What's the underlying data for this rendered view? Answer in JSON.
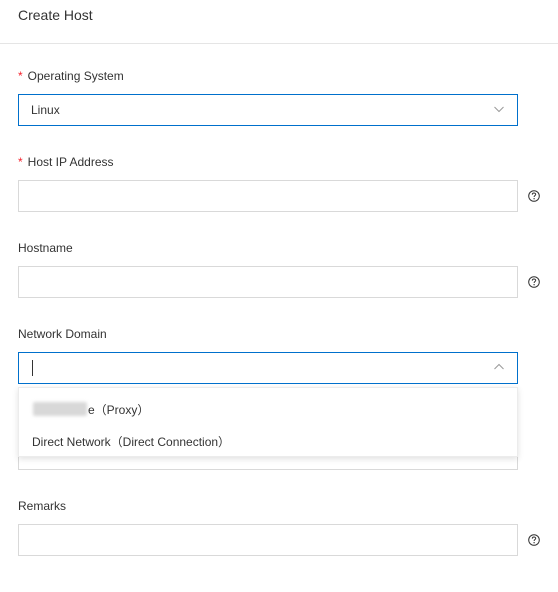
{
  "header": {
    "title": "Create Host"
  },
  "form": {
    "os": {
      "label": "Operating System",
      "required_mark": "*",
      "value": "Linux"
    },
    "host_ip": {
      "label": "Host IP Address",
      "required_mark": "*",
      "value": ""
    },
    "hostname": {
      "label": "Hostname",
      "value": ""
    },
    "network_domain": {
      "label": "Network Domain",
      "value": "",
      "options": [
        {
          "label_suffix": "e（Proxy）"
        },
        {
          "label": "Direct Network（Direct Connection）"
        }
      ]
    },
    "remarks": {
      "label": "Remarks",
      "value": ""
    }
  },
  "icons": {
    "help": "question-circle-icon",
    "dropdown_closed": "chevron-down-icon",
    "dropdown_open": "chevron-up-icon"
  },
  "colors": {
    "required": "#f5222d",
    "accent": "#0070cc",
    "border": "#d9d9d9"
  }
}
